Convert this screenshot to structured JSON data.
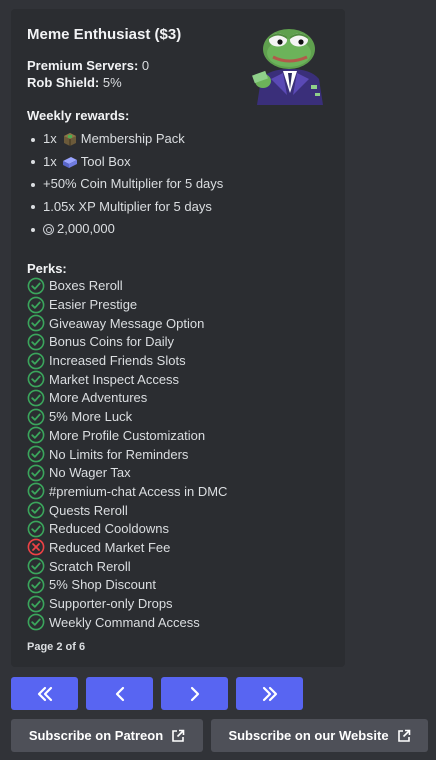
{
  "embed": {
    "title": "Meme Enthusiast ($3)",
    "premium_servers_label": "Premium Servers:",
    "premium_servers_value": "0",
    "rob_shield_label": "Rob Shield:",
    "rob_shield_value": "5%",
    "weekly_rewards_heading": "Weekly rewards:",
    "rewards": [
      {
        "qty": "1x",
        "icon": "membership-pack-icon",
        "text": "Membership Pack"
      },
      {
        "qty": "1x",
        "icon": "tool-box-icon",
        "text": "Tool Box"
      },
      {
        "text": "+50% Coin Multiplier for 5 days"
      },
      {
        "text": "1.05x XP Multiplier for 5 days"
      },
      {
        "icon": "coin-icon",
        "text": "2,000,000"
      }
    ],
    "perks_heading": "Perks:",
    "perks": [
      {
        "text": "Boxes Reroll",
        "ok": true
      },
      {
        "text": "Easier Prestige",
        "ok": true
      },
      {
        "text": "Giveaway Message Option",
        "ok": true
      },
      {
        "text": "Bonus Coins for Daily",
        "ok": true
      },
      {
        "text": "Increased Friends Slots",
        "ok": true
      },
      {
        "text": "Market Inspect Access",
        "ok": true
      },
      {
        "text": "More Adventures",
        "ok": true
      },
      {
        "text": "5% More Luck",
        "ok": true
      },
      {
        "text": "More Profile Customization",
        "ok": true
      },
      {
        "text": "No Limits for Reminders",
        "ok": true
      },
      {
        "text": "No Wager Tax",
        "ok": true
      },
      {
        "text": "#premium-chat Access in DMC",
        "ok": true
      },
      {
        "text": "Quests Reroll",
        "ok": true
      },
      {
        "text": "Reduced Cooldowns",
        "ok": true
      },
      {
        "text": "Reduced Market Fee",
        "ok": false
      },
      {
        "text": "Scratch Reroll",
        "ok": true
      },
      {
        "text": "5% Shop Discount",
        "ok": true
      },
      {
        "text": "Supporter-only Drops",
        "ok": true
      },
      {
        "text": "Weekly Command Access",
        "ok": true
      }
    ],
    "footer": "Page 2 of 6"
  },
  "nav": {
    "first": "«",
    "prev": "‹",
    "next": "›",
    "last": "»"
  },
  "links": {
    "patreon": "Subscribe on Patreon",
    "website": "Subscribe on our Website"
  },
  "colors": {
    "background": "#313338",
    "embed": "#2b2d31",
    "blurple": "#5865f2",
    "secondary_button": "#4e5058",
    "check": "#3ba55c",
    "cross": "#ed4245"
  }
}
